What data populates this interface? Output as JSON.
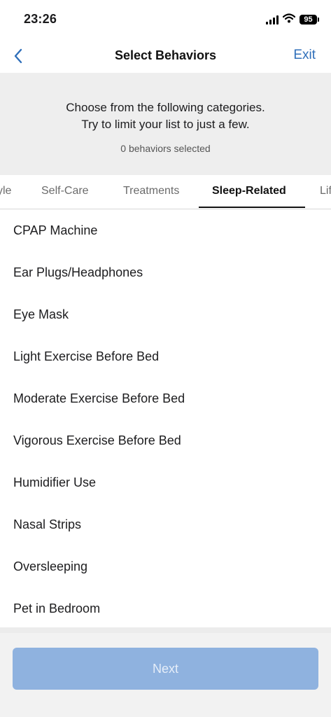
{
  "status_bar": {
    "time": "23:26",
    "battery": "95"
  },
  "nav": {
    "title": "Select Behaviors",
    "exit_label": "Exit"
  },
  "info": {
    "line1": "Choose from the following categories.",
    "line2": "Try to limit your list to just a few.",
    "selected_count": "0 behaviors selected"
  },
  "tabs": [
    {
      "label": "yle",
      "active": false
    },
    {
      "label": "Self-Care",
      "active": false
    },
    {
      "label": "Treatments",
      "active": false
    },
    {
      "label": "Sleep-Related",
      "active": true
    },
    {
      "label": "Lif",
      "active": false
    }
  ],
  "behaviors": [
    "CPAP Machine",
    "Ear Plugs/Headphones",
    "Eye Mask",
    "Light Exercise Before Bed",
    "Moderate Exercise Before Bed",
    "Vigorous Exercise Before Bed",
    "Humidifier Use",
    "Nasal Strips",
    "Oversleeping",
    "Pet in Bedroom"
  ],
  "footer": {
    "next_label": "Next"
  },
  "colors": {
    "accent": "#2f6fba",
    "button_disabled": "#8fb2df",
    "panel_bg": "#eeeeee"
  }
}
